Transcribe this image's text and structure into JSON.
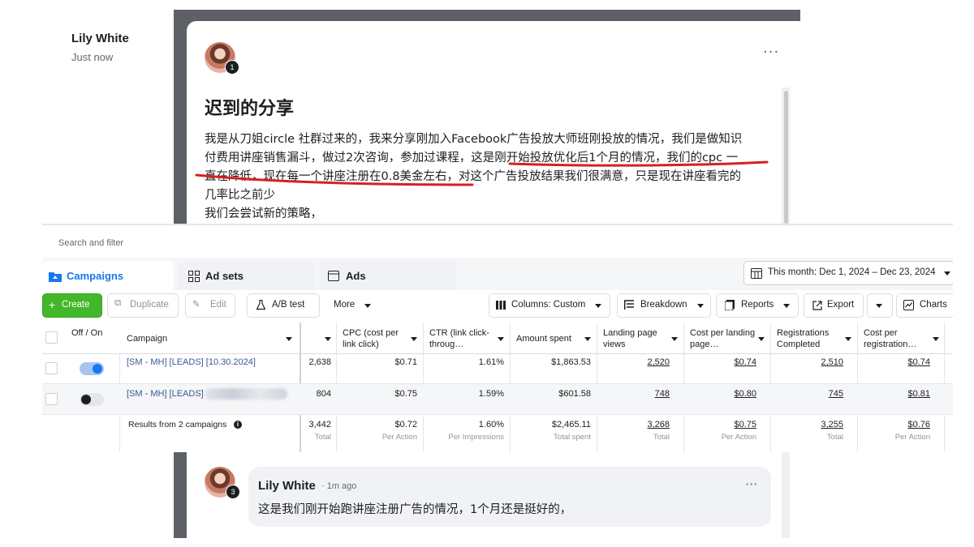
{
  "post": {
    "author": "Lily White",
    "time": "Just now",
    "avatar_badge": "1",
    "more": "···",
    "title": "迟到的分享",
    "lines": [
      "我是从刀姐circle 社群过来的，我来分享刚加入Facebook广告投放大师班刚投放的情况，我们是做知识",
      "付费用讲座销售漏斗，做过2次咨询，参加过课程，这是刚开始投放优化后1个月的情况，我们的cpc 一",
      "直在降低，现在每一个讲座注册在0.8美金左右，对这个广告投放结果我们很满意，只是现在讲座看完的",
      "几率比之前少",
      "我们会尝试新的策略，"
    ],
    "highlight_color": "#d62020"
  },
  "ads": {
    "search_placeholder": "Search and filter",
    "tabs": [
      "Campaigns",
      "Ad sets",
      "Ads"
    ],
    "date_range": "This month: Dec 1, 2024 – Dec 23, 2024",
    "toolbar": {
      "create": "Create",
      "duplicate": "Duplicate",
      "edit": "Edit",
      "ab_test": "A/B test",
      "more": "More",
      "columns": "Columns: Custom",
      "breakdown": "Breakdown",
      "reports": "Reports",
      "export": "Export",
      "charts": "Charts"
    },
    "columns": {
      "off_on": "Off / On",
      "campaign": "Campaign",
      "cpc": "CPC (cost per link click)",
      "ctr": "CTR (link click-throug…",
      "amount_spent": "Amount spent",
      "landing_page_views": "Landing page views",
      "cost_per_lpv": "Cost per landing page…",
      "registrations": "Registrations Completed",
      "cost_per_reg": "Cost per registration…"
    },
    "rows": [
      {
        "on": true,
        "campaign": "[SM - MH] [LEADS] [10.30.2024]",
        "results": "2,638",
        "cpc": "$0.71",
        "ctr": "1.61%",
        "amount_spent": "$1,863.53",
        "lpv": "2,520",
        "cost_lpv": "$0.74",
        "registrations": "2,510",
        "cost_reg": "$0.74"
      },
      {
        "on": false,
        "campaign": "[SM - MH] [LEADS]",
        "results": "804",
        "cpc": "$0.75",
        "ctr": "1.59%",
        "amount_spent": "$601.58",
        "lpv": "748",
        "cost_lpv": "$0.80",
        "registrations": "745",
        "cost_reg": "$0.81"
      }
    ],
    "totals": {
      "label": "Results from 2 campaigns",
      "results": "3,442",
      "results_sub": "Total",
      "cpc": "$0.72",
      "cpc_sub": "Per Action",
      "ctr": "1.60%",
      "ctr_sub": "Per Impressions",
      "amount_spent": "$2,465.11",
      "amount_sub": "Total spent",
      "lpv": "3,268",
      "lpv_sub": "Total",
      "cost_lpv": "$0.75",
      "cost_lpv_sub": "Per Action",
      "registrations": "3,255",
      "reg_sub": "Total",
      "cost_reg": "$0.76",
      "cost_reg_sub": "Per Action"
    },
    "colors": {
      "accent": "#1877f2",
      "create_green": "#42b72a",
      "link": "#385898"
    }
  },
  "comment": {
    "author": "Lily White",
    "time": "· 1m ago",
    "avatar_badge": "3",
    "more": "···",
    "text": "这是我们刚开始跑讲座注册广告的情况，1个月还是挺好的，"
  }
}
